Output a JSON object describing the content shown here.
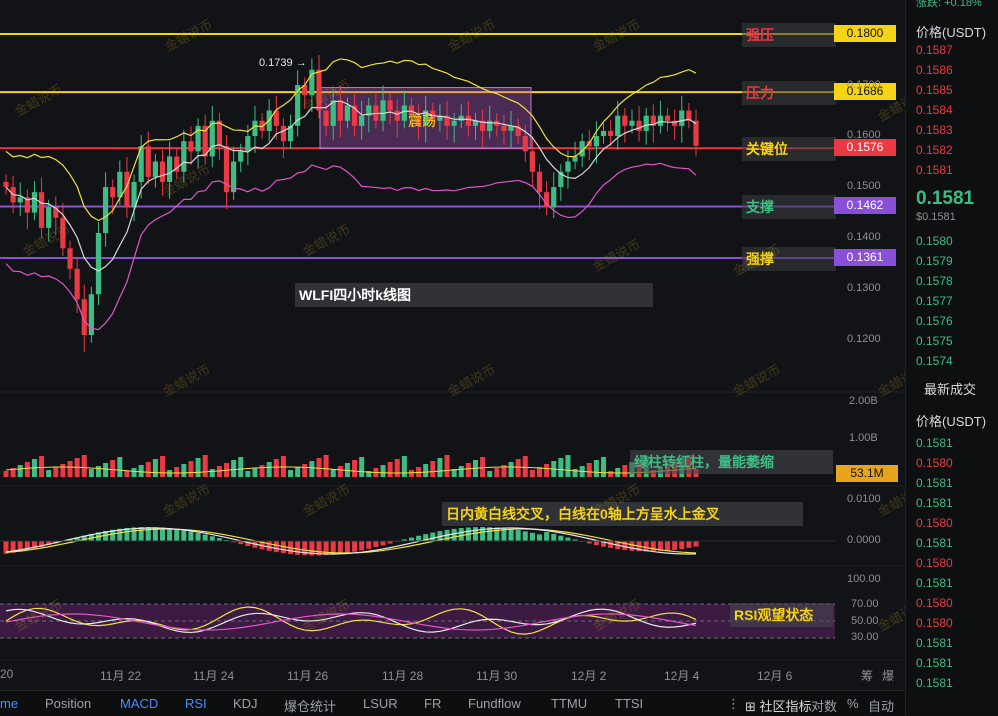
{
  "chart": {
    "title_annotation": "WLFI四小时k线图",
    "zone_label": "震荡",
    "peak_label": "0.1739 →",
    "levels": [
      {
        "name": "强压",
        "price": "0.1800",
        "line_color": "#f5d315",
        "tag_color": "#f5d315",
        "label_color": "#ea3943"
      },
      {
        "name": "压力",
        "price": "0.1686",
        "line_color": "#f5d315",
        "tag_color": "#f5d315",
        "label_color": "#ea3943"
      },
      {
        "name": "关键位",
        "price": "0.1576",
        "line_color": "#ea3943",
        "tag_color": "#ea3943",
        "label_color": "#f5d315"
      },
      {
        "name": "支撑",
        "price": "0.1462",
        "line_color": "#8a4fd8",
        "tag_color": "#8a4fd8",
        "label_color": "#3dbd84"
      },
      {
        "name": "强撑",
        "price": "0.1361",
        "line_color": "#8a4fd8",
        "tag_color": "#8a4fd8",
        "label_color": "#f5d315"
      }
    ],
    "price_axis": [
      "0.1600",
      "0.1500",
      "0.1400",
      "0.1300",
      "0.1200"
    ],
    "price_axis_partial": "0.1700",
    "volume_axis": [
      "2.00B",
      "1.00B"
    ],
    "volume_tag": "53.1M",
    "volume_annotation": "绿柱转红柱，量能萎缩",
    "macd_axis": [
      "0.0100",
      "0.0000"
    ],
    "macd_annotation": "日内黄白线交叉，白线在0轴上方呈水上金叉",
    "rsi_axis": [
      "100.00",
      "70.00",
      "50.00",
      "30.00"
    ],
    "rsi_annotation": "RSI观望状态",
    "date_axis": [
      "20",
      "11月 22",
      "11月 24",
      "11月 26",
      "11月 28",
      "11月 30",
      "12月 2",
      "12月 4",
      "12月 6"
    ],
    "date_axis_extra": [
      "筹",
      "爆"
    ],
    "watermark": "金蜡说币"
  },
  "right_panel": {
    "top_partial": "涨跌: +0.18%",
    "price_header": "价格(USDT)",
    "order_prices": [
      {
        "v": "0.1587",
        "c": "red"
      },
      {
        "v": "0.1586",
        "c": "red"
      },
      {
        "v": "0.1585",
        "c": "red"
      },
      {
        "v": "0.1584",
        "c": "red"
      },
      {
        "v": "0.1583",
        "c": "red"
      },
      {
        "v": "0.1582",
        "c": "red"
      },
      {
        "v": "0.1581",
        "c": "red"
      }
    ],
    "last_price": "0.1581",
    "last_price_usd": "$0.1581",
    "bid_prices": [
      "0.1580",
      "0.1579",
      "0.1578",
      "0.1577",
      "0.1576",
      "0.1575",
      "0.1574"
    ],
    "trades_title": "最新成交",
    "trades_header": "价格(USDT)",
    "trades": [
      {
        "v": "0.1581",
        "c": "green"
      },
      {
        "v": "0.1580",
        "c": "red"
      },
      {
        "v": "0.1581",
        "c": "green"
      },
      {
        "v": "0.1581",
        "c": "green"
      },
      {
        "v": "0.1580",
        "c": "red"
      },
      {
        "v": "0.1581",
        "c": "green"
      },
      {
        "v": "0.1580",
        "c": "red"
      },
      {
        "v": "0.1581",
        "c": "green"
      },
      {
        "v": "0.1580",
        "c": "red"
      },
      {
        "v": "0.1580",
        "c": "red"
      },
      {
        "v": "0.1581",
        "c": "green"
      },
      {
        "v": "0.1581",
        "c": "green"
      },
      {
        "v": "0.1581",
        "c": "green"
      }
    ]
  },
  "bottom_tabs": [
    "me",
    "Position",
    "MACD",
    "RSI",
    "KDJ",
    "爆仓统计",
    "LSUR",
    "FR",
    "Fundflow",
    "TTMU",
    "TTSI"
  ],
  "bottom_right": [
    "社区指标",
    "对数",
    "%",
    "自动"
  ],
  "colors": {
    "up": "#3dbd84",
    "down": "#ea3943",
    "accent": "#4b8df8"
  }
}
